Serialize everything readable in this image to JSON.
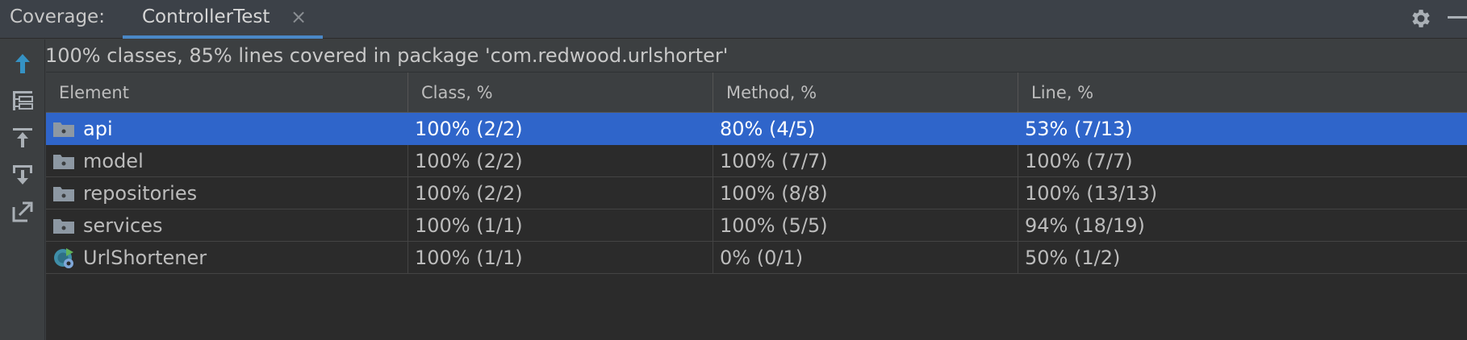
{
  "header": {
    "label": "Coverage:",
    "active_tab": "ControllerTest",
    "close_glyph": "×",
    "icons": [
      "gear-icon",
      "minimize-icon"
    ]
  },
  "toolbar": {
    "icons": [
      "arrow-up-icon",
      "flatten-packages-icon",
      "import-icon",
      "export-icon",
      "generate-report-icon"
    ]
  },
  "summary": "100% classes, 85% lines covered in package 'com.redwood.urlshorter'",
  "table": {
    "columns": [
      "Element",
      "Class, %",
      "Method, %",
      "Line, %"
    ],
    "rows": [
      {
        "icon": "package-icon",
        "element": "api",
        "class": "100% (2/2)",
        "method": "80% (4/5)",
        "line": "53% (7/13)",
        "selected": true
      },
      {
        "icon": "package-icon",
        "element": "model",
        "class": "100% (2/2)",
        "method": "100% (7/7)",
        "line": "100% (7/7)",
        "selected": false
      },
      {
        "icon": "package-icon",
        "element": "repositories",
        "class": "100% (2/2)",
        "method": "100% (8/8)",
        "line": "100% (13/13)",
        "selected": false
      },
      {
        "icon": "package-icon",
        "element": "services",
        "class": "100% (1/1)",
        "method": "100% (5/5)",
        "line": "94% (18/19)",
        "selected": false
      },
      {
        "icon": "spring-boot-class-icon",
        "element": "UrlShortener",
        "class": "100% (1/1)",
        "method": "0% (0/1)",
        "line": "50% (1/2)",
        "selected": false
      }
    ]
  },
  "colors": {
    "selection": "#2f65ca",
    "tab_underline": "#4a88c7",
    "toolbar_accent": "#3592c4"
  }
}
